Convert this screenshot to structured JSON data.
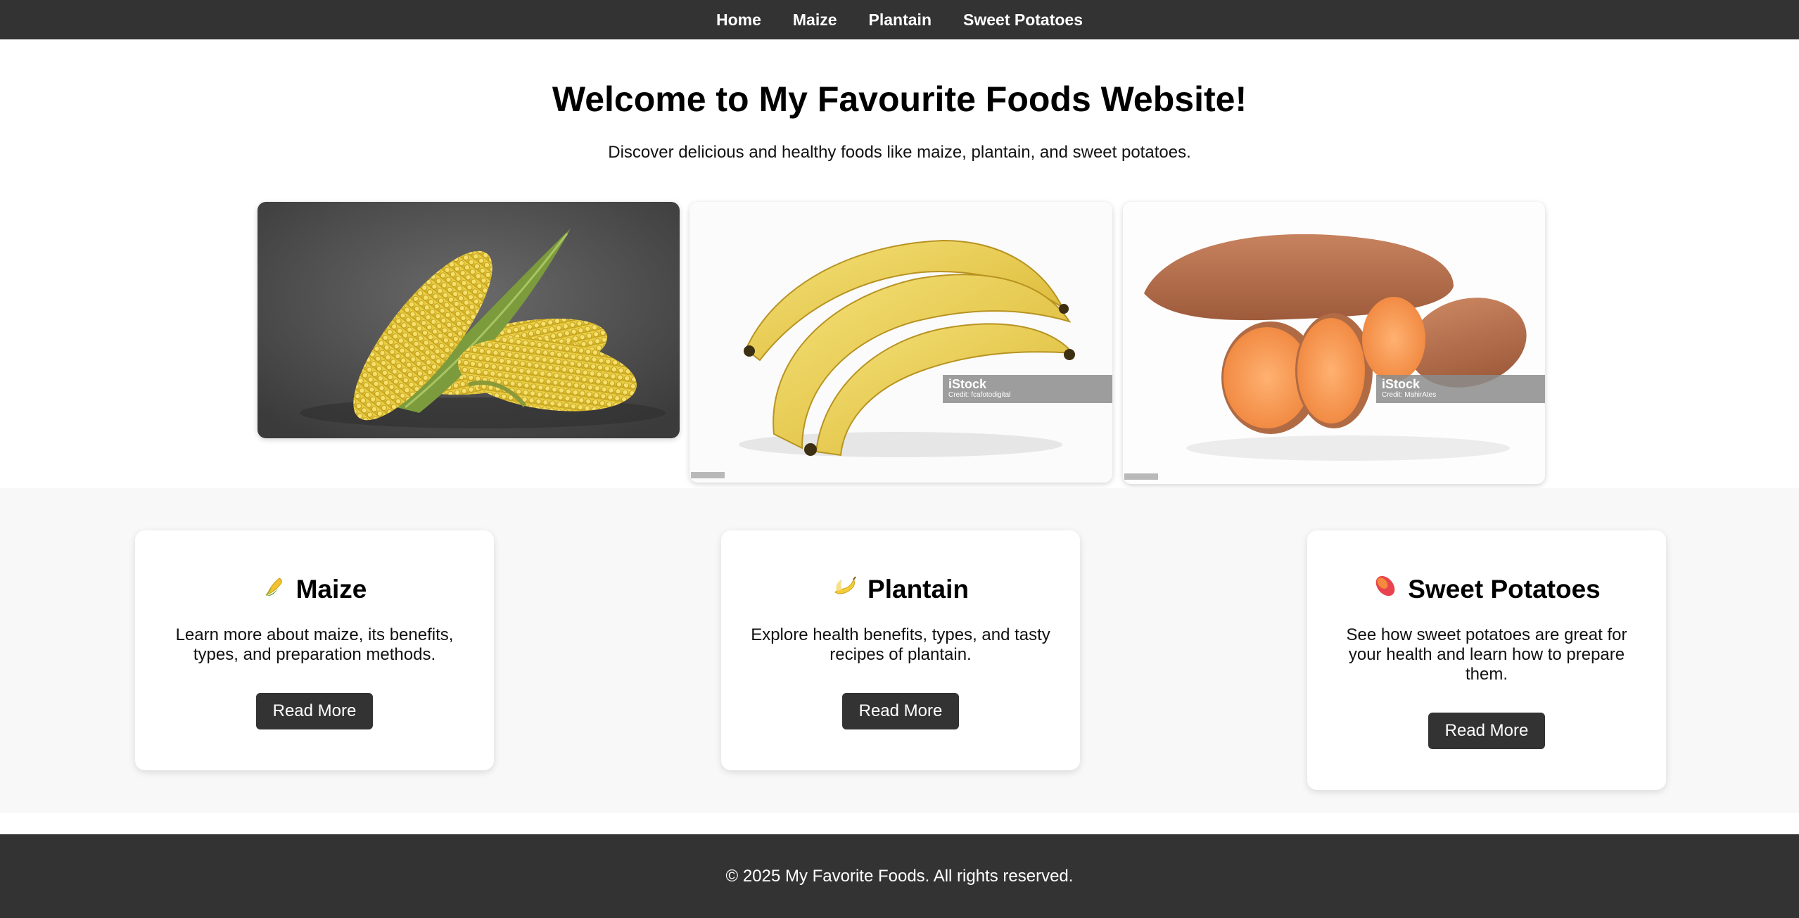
{
  "nav": {
    "items": [
      {
        "label": "Home"
      },
      {
        "label": "Maize"
      },
      {
        "label": "Plantain"
      },
      {
        "label": "Sweet Potatoes"
      }
    ]
  },
  "hero": {
    "title": "Welcome to My Favourite Foods Website!",
    "subtitle": "Discover delicious and healthy foods like maize, plantain, and sweet potatoes."
  },
  "images": {
    "plantain": {
      "brand": "iStock",
      "credit": "Credit: fcafotodigital"
    },
    "potato": {
      "brand": "iStock",
      "credit": "Credit: MahirAtes"
    }
  },
  "features": [
    {
      "icon": "corn-icon",
      "title": "Maize",
      "text": "Learn more about maize, its benefits, types, and preparation methods.",
      "button": "Read More"
    },
    {
      "icon": "banana-icon",
      "title": "Plantain",
      "text": "Explore health benefits, types, and tasty recipes of plantain.",
      "button": "Read More"
    },
    {
      "icon": "sweet-potato-icon",
      "title": "Sweet Potatoes",
      "text": "See how sweet potatoes are great for your health and learn how to prepare them.",
      "button": "Read More"
    }
  ],
  "footer": {
    "text": "© 2025 My Favorite Foods. All rights reserved."
  },
  "colors": {
    "dark": "#333333",
    "section_bg": "#f8f8f8"
  }
}
